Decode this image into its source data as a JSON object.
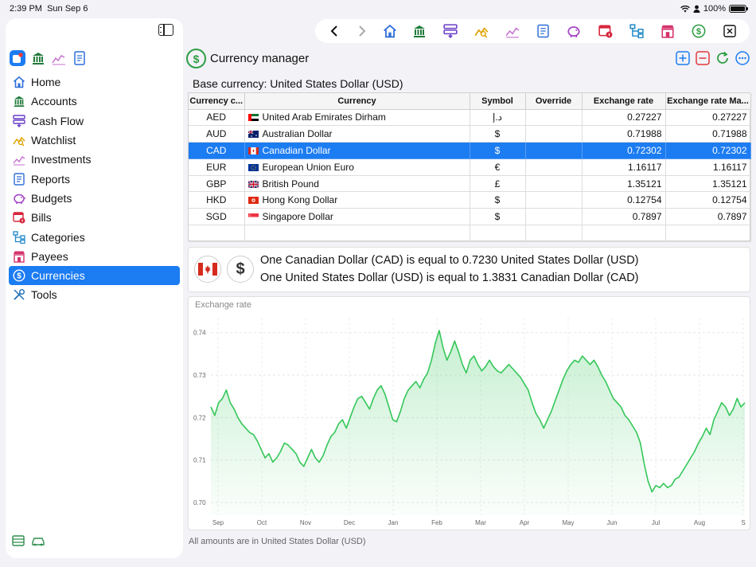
{
  "status": {
    "time": "2:39 PM",
    "date": "Sun Sep 6",
    "battery": "100%"
  },
  "sidebar": {
    "items": [
      {
        "label": "Home",
        "icon": "house-icon"
      },
      {
        "label": "Accounts",
        "icon": "bank-icon"
      },
      {
        "label": "Cash Flow",
        "icon": "cash-flow-icon"
      },
      {
        "label": "Watchlist",
        "icon": "watchlist-icon"
      },
      {
        "label": "Investments",
        "icon": "investments-chart-icon"
      },
      {
        "label": "Reports",
        "icon": "report-doc-icon"
      },
      {
        "label": "Budgets",
        "icon": "piggy-bank-icon"
      },
      {
        "label": "Bills",
        "icon": "calendar-bill-icon"
      },
      {
        "label": "Categories",
        "icon": "hierarchy-icon"
      },
      {
        "label": "Payees",
        "icon": "storefront-icon"
      },
      {
        "label": "Currencies",
        "icon": "dollar-circle-icon"
      },
      {
        "label": "Tools",
        "icon": "tools-icon"
      }
    ],
    "active_index": 10
  },
  "page": {
    "title": "Currency manager"
  },
  "base_currency": "Base currency: United States Dollar (USD)",
  "table": {
    "columns": [
      "Currency c...",
      "Currency",
      "Symbol",
      "Override",
      "Exchange rate",
      "Exchange rate Ma..."
    ],
    "rows": [
      {
        "code": "AED",
        "flag": "ae",
        "name": "United Arab Emirates Dirham",
        "symbol": "د.إ",
        "override": "",
        "rate": "0.27227",
        "market": "0.27227"
      },
      {
        "code": "AUD",
        "flag": "au",
        "name": "Australian Dollar",
        "symbol": "$",
        "override": "",
        "rate": "0.71988",
        "market": "0.71988"
      },
      {
        "code": "CAD",
        "flag": "ca",
        "name": "Canadian Dollar",
        "symbol": "$",
        "override": "",
        "rate": "0.72302",
        "market": "0.72302"
      },
      {
        "code": "EUR",
        "flag": "eu",
        "name": "European Union Euro",
        "symbol": "€",
        "override": "",
        "rate": "1.16117",
        "market": "1.16117"
      },
      {
        "code": "GBP",
        "flag": "gb",
        "name": "British Pound",
        "symbol": "£",
        "override": "",
        "rate": "1.35121",
        "market": "1.35121"
      },
      {
        "code": "HKD",
        "flag": "hk",
        "name": "Hong Kong Dollar",
        "symbol": "$",
        "override": "",
        "rate": "0.12754",
        "market": "0.12754"
      },
      {
        "code": "SGD",
        "flag": "sg",
        "name": "Singapore Dollar",
        "symbol": "$",
        "override": "",
        "rate": "0.7897",
        "market": "0.7897"
      }
    ],
    "selected_index": 2
  },
  "conversion": {
    "usd_symbol": "$",
    "line1": "One Canadian Dollar (CAD) is equal to 0.7230 United States Dollar (USD)",
    "line2": "One United States Dollar (USD) is equal to 1.3831 Canadian Dollar (CAD)"
  },
  "chart_data": {
    "type": "area",
    "title": "Exchange rate",
    "x_tick_labels": [
      "Sep",
      "Oct",
      "Nov",
      "Dec",
      "Jan",
      "Feb",
      "Mar",
      "Apr",
      "May",
      "Jun",
      "Jul",
      "Aug",
      "S"
    ],
    "y_ticks": [
      0.7,
      0.71,
      0.72,
      0.73,
      0.74
    ],
    "y_tick_labels": [
      "0.70",
      "0.71",
      "0.72",
      "0.73",
      "0.74"
    ],
    "ylim": [
      0.697,
      0.7435
    ],
    "grid": true,
    "line_color": "#34c759",
    "values": [
      0.7225,
      0.7205,
      0.7235,
      0.7245,
      0.7265,
      0.7235,
      0.722,
      0.72,
      0.7185,
      0.7175,
      0.7165,
      0.716,
      0.7145,
      0.7125,
      0.7105,
      0.7115,
      0.7095,
      0.7105,
      0.712,
      0.714,
      0.7135,
      0.7125,
      0.7115,
      0.7095,
      0.7085,
      0.7105,
      0.7125,
      0.7105,
      0.7095,
      0.711,
      0.7135,
      0.7155,
      0.7165,
      0.7185,
      0.7195,
      0.7175,
      0.72,
      0.7225,
      0.7245,
      0.725,
      0.7235,
      0.722,
      0.7245,
      0.7265,
      0.7275,
      0.7255,
      0.7225,
      0.7195,
      0.719,
      0.7215,
      0.7245,
      0.7265,
      0.7275,
      0.7285,
      0.727,
      0.729,
      0.7305,
      0.7335,
      0.7375,
      0.7405,
      0.7365,
      0.7335,
      0.7355,
      0.738,
      0.7355,
      0.7325,
      0.7305,
      0.7335,
      0.7345,
      0.7325,
      0.731,
      0.732,
      0.7335,
      0.732,
      0.731,
      0.7305,
      0.7315,
      0.7325,
      0.7315,
      0.7305,
      0.7295,
      0.728,
      0.7265,
      0.7235,
      0.721,
      0.7195,
      0.7175,
      0.7195,
      0.7215,
      0.724,
      0.7265,
      0.729,
      0.731,
      0.7325,
      0.7335,
      0.733,
      0.7345,
      0.7335,
      0.7325,
      0.7335,
      0.732,
      0.73,
      0.7285,
      0.7265,
      0.7245,
      0.7235,
      0.7225,
      0.7205,
      0.7195,
      0.718,
      0.7165,
      0.714,
      0.709,
      0.705,
      0.7025,
      0.704,
      0.7035,
      0.7045,
      0.7035,
      0.704,
      0.7055,
      0.706,
      0.7075,
      0.709,
      0.7105,
      0.712,
      0.714,
      0.7155,
      0.7175,
      0.716,
      0.7195,
      0.7215,
      0.7235,
      0.7225,
      0.7205,
      0.722,
      0.7245,
      0.7225,
      0.7235
    ]
  },
  "footnote": "All amounts are in United States Dollar (USD)"
}
